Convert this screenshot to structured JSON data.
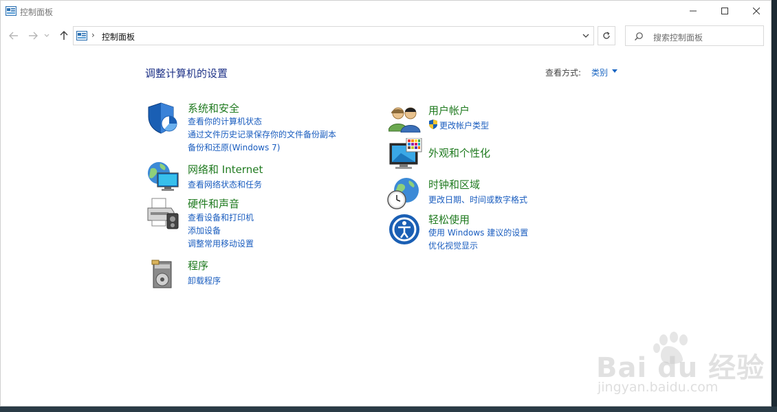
{
  "window": {
    "title": "控制面板",
    "minimize_icon": "minimize-icon",
    "maximize_icon": "maximize-icon",
    "close_icon": "close-icon"
  },
  "nav": {
    "address_path": "控制面板",
    "address_separator": "›",
    "search_placeholder": "搜索控制面板"
  },
  "content": {
    "heading": "调整计算机的设置",
    "view_by_label": "查看方式:",
    "view_by_value": "类别"
  },
  "categories_left": [
    {
      "title": "系统和安全",
      "icon": "shield-icon",
      "links": [
        "查看你的计算机状态",
        "通过文件历史记录保存你的文件备份副本",
        "备份和还原(Windows 7)"
      ]
    },
    {
      "title": "网络和 Internet",
      "icon": "network-icon",
      "links": [
        "查看网络状态和任务"
      ]
    },
    {
      "title": "硬件和声音",
      "icon": "printer-icon",
      "links": [
        "查看设备和打印机",
        "添加设备",
        "调整常用移动设置"
      ]
    },
    {
      "title": "程序",
      "icon": "programs-icon",
      "links": [
        "卸载程序"
      ]
    }
  ],
  "categories_right": [
    {
      "title": "用户帐户",
      "icon": "users-icon",
      "links": [
        "更改帐户类型"
      ]
    },
    {
      "title": "外观和个性化",
      "icon": "appearance-icon",
      "links": []
    },
    {
      "title": "时钟和区域",
      "icon": "clock-globe-icon",
      "links": [
        "更改日期、时间或数字格式"
      ]
    },
    {
      "title": "轻松使用",
      "icon": "ease-of-access-icon",
      "links": [
        "使用 Windows 建议的设置",
        "优化视觉显示"
      ]
    }
  ],
  "watermark": {
    "brand": "Bai du 经验",
    "url": "jingyan.baidu.com"
  },
  "colors": {
    "heading": "#1e3287",
    "category_title": "#1f7a1f",
    "link": "#1a5dbf"
  }
}
